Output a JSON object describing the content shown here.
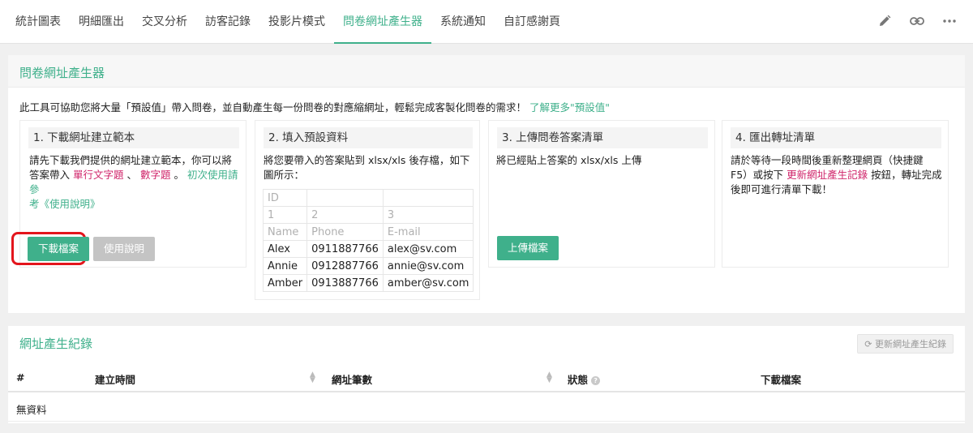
{
  "tabs": [
    {
      "label": "統計圖表"
    },
    {
      "label": "明細匯出"
    },
    {
      "label": "交叉分析"
    },
    {
      "label": "訪客記錄"
    },
    {
      "label": "投影片模式"
    },
    {
      "label": "問卷網址產生器"
    },
    {
      "label": "系統通知"
    },
    {
      "label": "自訂感謝頁"
    }
  ],
  "active_tab": "問卷網址產生器",
  "top_icons": [
    "pencil-icon",
    "link-icon",
    "more-icon"
  ],
  "generator": {
    "title": "問卷網址產生器",
    "intro": "此工具可協助您將大量「預設值」帶入問卷，並自動產生每一份問卷的對應縮網址，輕鬆完成客製化問卷的需求！",
    "intro_link": "了解更多\"預設值\"",
    "step1": {
      "title": "1. 下載網址建立範本",
      "text1": "請先下載我們提供的網址建立範本，你可以將",
      "text2": "答案帶入",
      "type1": "單行文字題",
      "sep": "、",
      "type2": "數字題",
      "dot": "。",
      "guide1": "初次使用請參",
      "guide2": "考《使用說明》",
      "download_btn": "下載檔案",
      "guide_btn": "使用說明"
    },
    "step2": {
      "title": "2. 填入預設資料",
      "text1": "將您要帶入的答案貼到 xlsx/xls 後存檔，如下",
      "text2": "圖所示：",
      "table": [
        [
          "ID",
          "",
          ""
        ],
        [
          "1",
          "2",
          "3"
        ],
        [
          "Name",
          "Phone",
          "E-mail"
        ],
        [
          "Alex",
          "0911887766",
          "alex@sv.com"
        ],
        [
          "Annie",
          "0912887766",
          "annie@sv.com"
        ],
        [
          "Amber",
          "0913887766",
          "amber@sv.com"
        ]
      ]
    },
    "step3": {
      "title": "3. 上傳問卷答案清單",
      "text": "將已經貼上答案的 xlsx/xls 上傳",
      "upload_btn": "上傳檔案"
    },
    "step4": {
      "title": "4. 匯出轉址清單",
      "text1": "請於等待一段時間後重新整理網頁（快捷鍵",
      "text2a": "F5）或按下",
      "text2_link": "更新網址產生記錄",
      "text2b": "按鈕，轉址完成",
      "text3": "後即可進行清單下載！"
    }
  },
  "records": {
    "title": "網址產生紀錄",
    "refresh_btn": "更新網址產生紀錄",
    "columns": [
      "#",
      "建立時間",
      "網址筆數",
      "狀態",
      "下載檔案"
    ],
    "empty": "無資料"
  },
  "colors": {
    "accent": "#3fb08b",
    "pink": "#d0266b",
    "highlight": "#e3151c"
  }
}
